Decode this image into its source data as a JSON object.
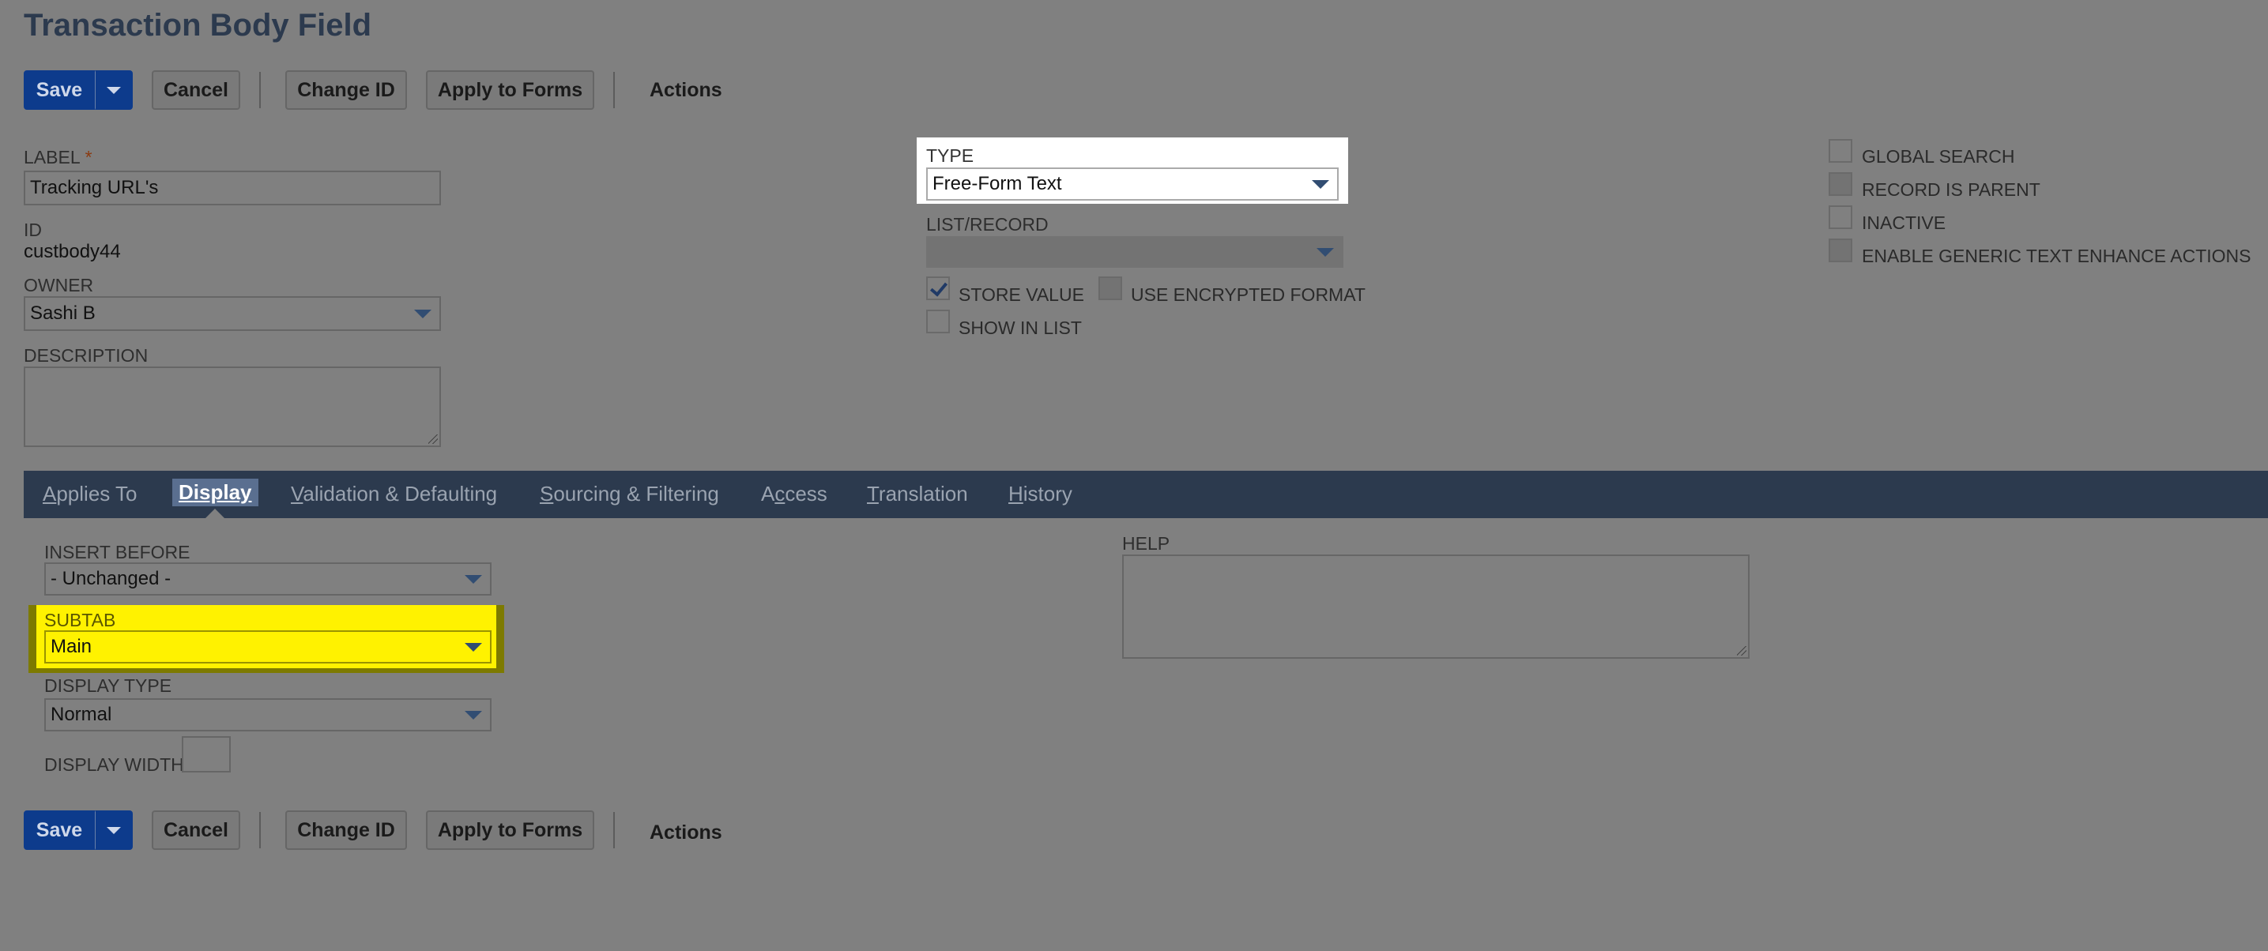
{
  "page_title": "Transaction Body Field",
  "toolbar": {
    "save": "Save",
    "cancel": "Cancel",
    "change_id": "Change ID",
    "apply_to_forms": "Apply to Forms",
    "actions": "Actions"
  },
  "fields": {
    "label": {
      "label": "LABEL",
      "required_mark": "*",
      "value": "Tracking URL's"
    },
    "id": {
      "label": "ID",
      "value": "custbody44"
    },
    "owner": {
      "label": "OWNER",
      "value": "Sashi B"
    },
    "description": {
      "label": "DESCRIPTION",
      "value": ""
    },
    "type": {
      "label": "TYPE",
      "value": "Free-Form Text"
    },
    "list_record": {
      "label": "LIST/RECORD",
      "value": ""
    },
    "store_value": {
      "label": "STORE VALUE",
      "checked": true
    },
    "use_encrypted": {
      "label": "USE ENCRYPTED FORMAT",
      "checked": false
    },
    "show_in_list": {
      "label": "SHOW IN LIST",
      "checked": false
    },
    "global_search": {
      "label": "GLOBAL SEARCH",
      "checked": false
    },
    "record_is_parent": {
      "label": "RECORD IS PARENT",
      "checked": false
    },
    "inactive": {
      "label": "INACTIVE",
      "checked": false
    },
    "enable_generic": {
      "label": "ENABLE GENERIC TEXT ENHANCE ACTIONS",
      "checked": false
    }
  },
  "tabs": [
    {
      "pre": "",
      "key": "A",
      "post": "pplies To",
      "active": false
    },
    {
      "pre": "",
      "key": "D",
      "post": "isplay",
      "active": true
    },
    {
      "pre": "",
      "key": "V",
      "post": "alidation & Defaulting",
      "active": false
    },
    {
      "pre": "",
      "key": "S",
      "post": "ourcing & Filtering",
      "active": false
    },
    {
      "pre": "A",
      "key": "c",
      "post": "cess",
      "active": false
    },
    {
      "pre": "",
      "key": "T",
      "post": "ranslation",
      "active": false
    },
    {
      "pre": "",
      "key": "H",
      "post": "istory",
      "active": false
    }
  ],
  "display": {
    "insert_before": {
      "label": "INSERT BEFORE",
      "value": "- Unchanged -"
    },
    "subtab": {
      "label": "SUBTAB",
      "value": "Main"
    },
    "display_type": {
      "label": "DISPLAY TYPE",
      "value": "Normal"
    },
    "display_width": {
      "label": "DISPLAY WIDTH",
      "value": ""
    },
    "help": {
      "label": "HELP",
      "value": ""
    }
  },
  "colors": {
    "background": "#808080",
    "save_button": "#0d3b8c",
    "tabbar": "#2c3a4e",
    "highlight_yellow": "#fff200",
    "highlight_white": "#ffffff"
  }
}
